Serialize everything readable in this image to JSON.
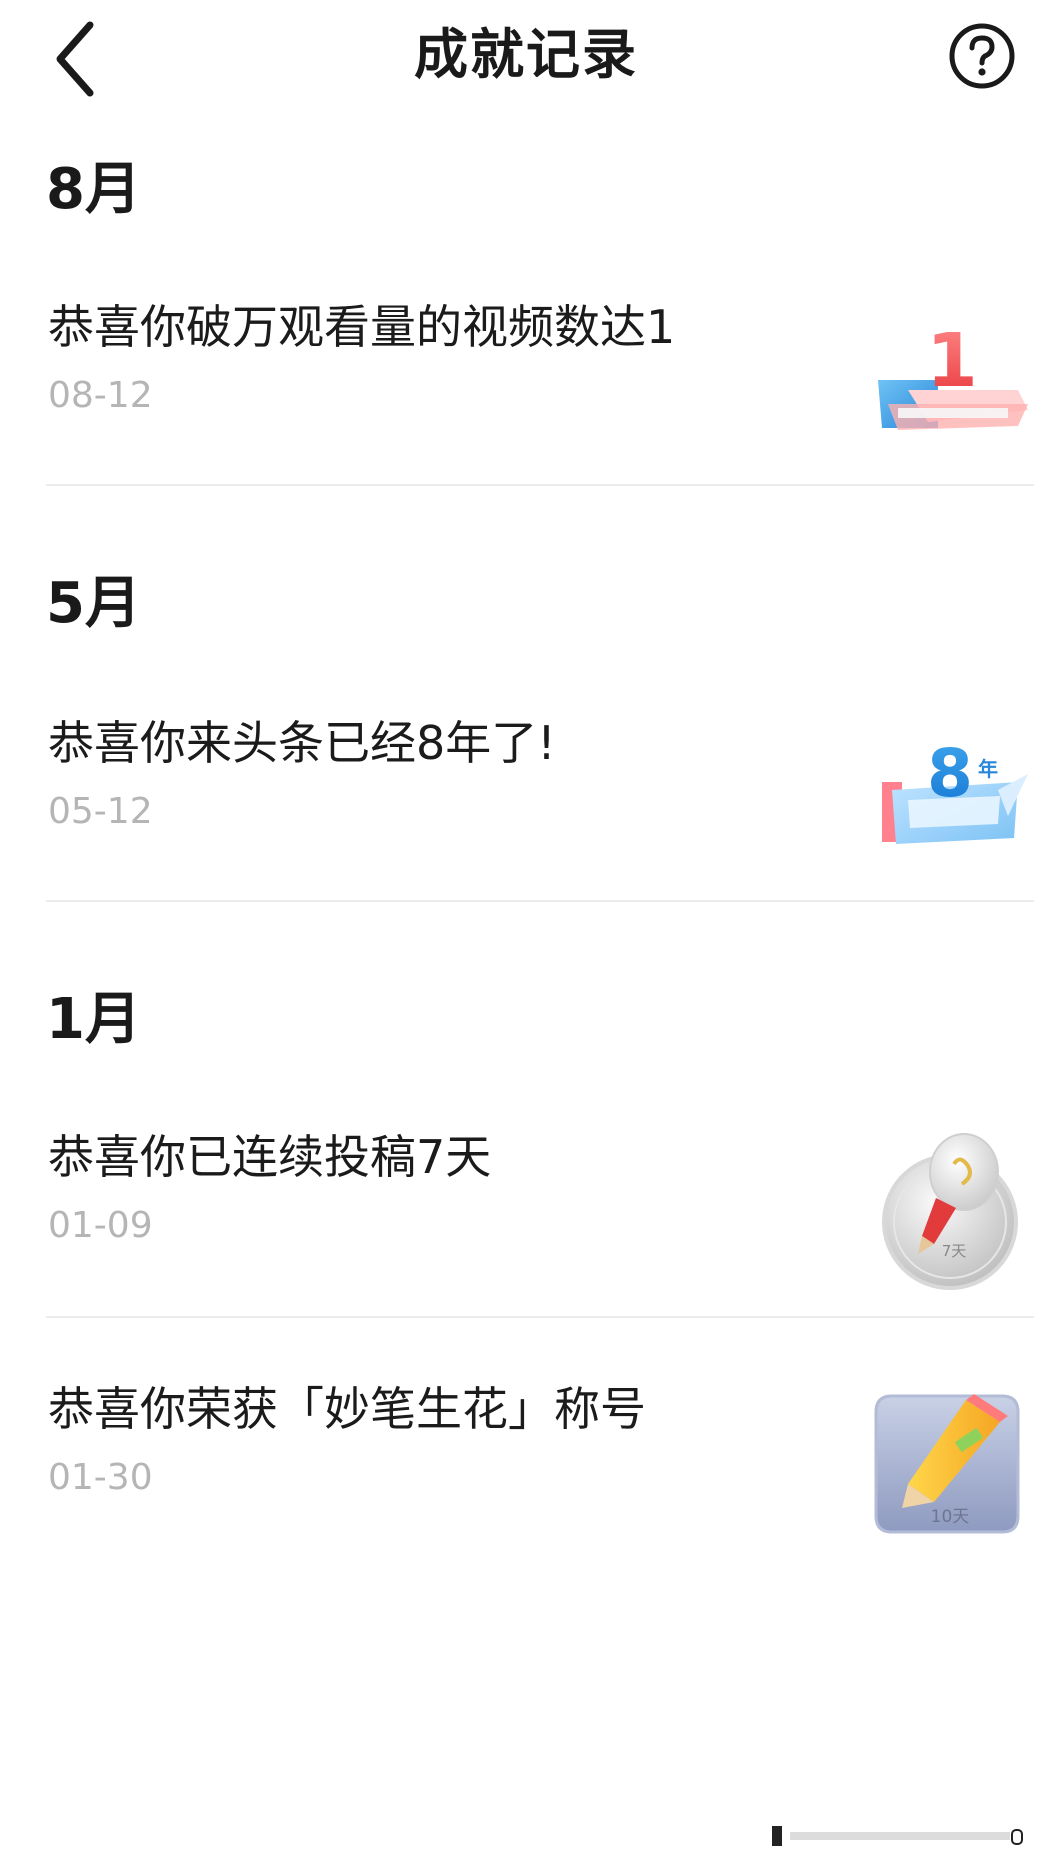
{
  "header": {
    "title": "成就记录",
    "back_icon": "chevron-left-icon",
    "help_icon": "help-circle-icon"
  },
  "sections": [
    {
      "month": "8月",
      "items": [
        {
          "title": "恭喜你破万观看量的视频数达1",
          "date": "08-12",
          "badge_text": "1",
          "badge_icon": "number-one-book-icon"
        }
      ]
    },
    {
      "month": "5月",
      "items": [
        {
          "title": "恭喜你来头条已经8年了!",
          "date": "05-12",
          "badge_text": "8",
          "badge_sub": "年",
          "badge_icon": "eight-year-anniversary-icon"
        }
      ]
    },
    {
      "month": "1月",
      "items": [
        {
          "title": "恭喜你已连续投稿7天",
          "date": "01-09",
          "badge_text": "7天",
          "badge_icon": "lightbulb-pen-medal-icon"
        },
        {
          "title": "恭喜你荣获「妙笔生花」称号",
          "date": "01-30",
          "badge_text": "10天",
          "badge_icon": "pencil-badge-icon"
        }
      ]
    }
  ],
  "colors": {
    "text_primary": "#1a1a1a",
    "text_secondary": "#b5b5b5",
    "divider": "#ececec",
    "badge_red": "#f04a4a",
    "badge_blue": "#3a9be8"
  }
}
